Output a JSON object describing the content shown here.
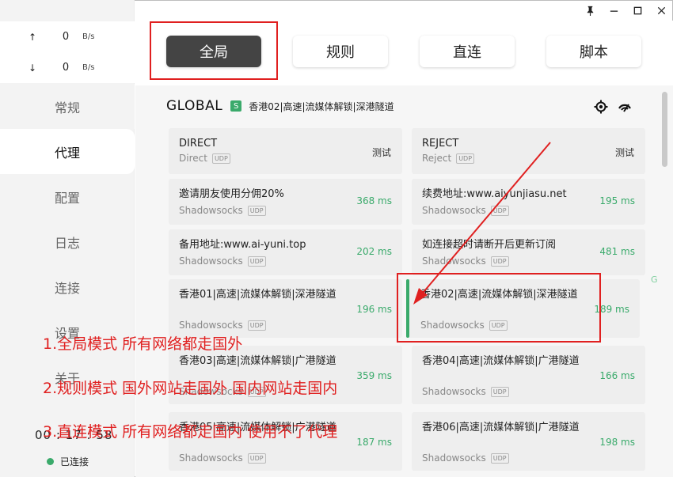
{
  "titlebar": {
    "pin_icon": "pin-icon",
    "minimize_icon": "minimize-icon",
    "maximize_icon": "maximize-icon",
    "close_icon": "close-icon"
  },
  "traffic": {
    "up": {
      "arrow": "↑",
      "value": "0",
      "unit": "B/s"
    },
    "down": {
      "arrow": "↓",
      "value": "0",
      "unit": "B/s"
    }
  },
  "sidebar": {
    "items": [
      {
        "label": "常规"
      },
      {
        "label": "代理"
      },
      {
        "label": "配置"
      },
      {
        "label": "日志"
      },
      {
        "label": "连接"
      },
      {
        "label": "设置"
      },
      {
        "label": "关于"
      }
    ],
    "active": "代理",
    "clock": "00 : 17 : 58",
    "status": "已连接"
  },
  "modes": [
    {
      "label": "全局",
      "active": true
    },
    {
      "label": "规则",
      "active": false
    },
    {
      "label": "直连",
      "active": false
    },
    {
      "label": "脚本",
      "active": false
    }
  ],
  "group": {
    "title": "GLOBAL",
    "badge": "S",
    "selected": "香港02|高速|流媒体解锁|深港隧道"
  },
  "proxies": [
    {
      "name": "DIRECT",
      "type": "Direct",
      "udp": "UDP",
      "action": "测试"
    },
    {
      "name": "REJECT",
      "type": "Reject",
      "udp": "UDP",
      "action": "测试"
    },
    {
      "name": "邀请朋友使用分佣20%",
      "type": "Shadowsocks",
      "udp": "UDP",
      "delay": "368 ms"
    },
    {
      "name": "续费地址:www.aiyunjiasu.net",
      "type": "Shadowsocks",
      "udp": "UDP",
      "delay": "195 ms"
    },
    {
      "name": "备用地址:www.ai-yuni.top",
      "type": "Shadowsocks",
      "udp": "UDP",
      "delay": "202 ms"
    },
    {
      "name": "如连接超时请断开后更新订阅",
      "type": "Shadowsocks",
      "udp": "UDP",
      "delay": "481 ms"
    },
    {
      "name": "香港01|高速|流媒体解锁|深港隧道",
      "type": "Shadowsocks",
      "udp": "UDP",
      "delay": "196 ms"
    },
    {
      "name": "香港02|高速|流媒体解锁|深港隧道",
      "type": "Shadowsocks",
      "udp": "UDP",
      "delay": "189 ms",
      "selected": true
    },
    {
      "name": "香港03|高速|流媒体解锁|广港隧道",
      "type": "Shadowsocks",
      "udp": "UDP",
      "delay": "359 ms"
    },
    {
      "name": "香港04|高速|流媒体解锁|广港隧道",
      "type": "Shadowsocks",
      "udp": "UDP",
      "delay": "166 ms"
    },
    {
      "name": "香港05|高速|流媒体解锁|广港隧道",
      "type": "Shadowsocks",
      "udp": "UDP",
      "delay": "187 ms"
    },
    {
      "name": "香港06|高速|流媒体解锁|广港隧道",
      "type": "Shadowsocks",
      "udp": "UDP",
      "delay": "198 ms"
    }
  ],
  "annotations": {
    "line1": "1.全局模式 所有网络都走国外",
    "line2": "2.规则模式 国外网站走国外 国内网站走国内",
    "line3": "3.直连模式 所有网络都走国内 使用不了代理",
    "color": "#e02020"
  },
  "stray_letter": "G",
  "colors": {
    "accent": "#3aaa6b",
    "active_mode": "#444444",
    "annotation": "#e02020"
  }
}
